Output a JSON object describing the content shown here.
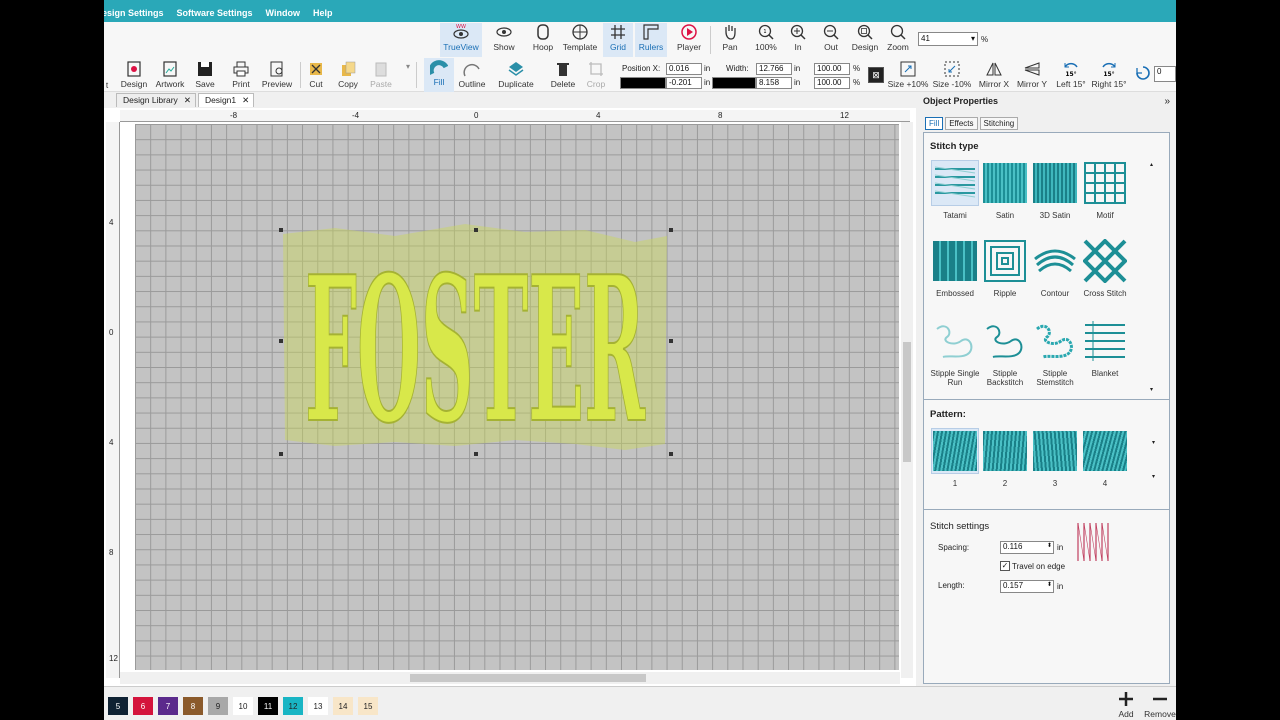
{
  "menu": [
    "esign Settings",
    "Software Settings",
    "Window",
    "Help"
  ],
  "toolbar_top": {
    "items": [
      "TrueView",
      "Show",
      "Hoop",
      "Template",
      "Grid",
      "Rulers",
      "Player",
      "Pan",
      "100%",
      "In",
      "Out",
      "Design",
      "Zoom"
    ],
    "zoom_value": "41",
    "zoom_unit": "%"
  },
  "toolbar_main": {
    "items": [
      "Design",
      "Artwork",
      "Save",
      "Print",
      "Preview",
      "Cut",
      "Copy",
      "Paste",
      "Fill",
      "Outline",
      "Duplicate",
      "Delete",
      "Crop"
    ],
    "position_label": "Position X:",
    "pos_x": "0.016",
    "pos_y": "-0.201",
    "unit": "in",
    "width_label": "Width:",
    "width": "12.766",
    "height": "8.158",
    "scale_x": "100.00",
    "scale_y": "100.00",
    "pct": "%",
    "right_items": [
      "Size +10%",
      "Size -10%",
      "Mirror X",
      "Mirror Y",
      "Left 15°",
      "Right 15°"
    ],
    "rotate_badge": "15°",
    "rotate_value": "0"
  },
  "doc_tabs": [
    "Design Library",
    "Design1"
  ],
  "ruler_top": [
    "-8",
    "-4",
    "0",
    "4",
    "8",
    "12"
  ],
  "ruler_left": [
    "4",
    "0",
    "4",
    "8",
    "12"
  ],
  "design_text": "FOSTER",
  "panel": {
    "title": "Object Properties",
    "tabs": [
      "Fill",
      "Effects",
      "Stitching"
    ],
    "stitch_type_label": "Stitch type",
    "stitch_types": [
      "Tatami",
      "Satin",
      "3D Satin",
      "Motif",
      "Embossed",
      "Ripple",
      "Contour",
      "Cross Stitch",
      "Stipple Single Run",
      "Stipple Backstitch",
      "Stipple Stemstitch",
      "Blanket"
    ],
    "pattern_label": "Pattern:",
    "patterns": [
      "1",
      "2",
      "3",
      "4"
    ],
    "stitch_settings_label": "Stitch settings",
    "spacing_label": "Spacing:",
    "spacing": "0.116",
    "travel_label": "Travel on edge",
    "length_label": "Length:",
    "length": "0.157",
    "unit": "in"
  },
  "colors": [
    {
      "n": "5",
      "c": "#0f2233",
      "fg": "#ffffff"
    },
    {
      "n": "6",
      "c": "#d4143c",
      "fg": "#ffffff"
    },
    {
      "n": "7",
      "c": "#5b2a8c",
      "fg": "#ffffff"
    },
    {
      "n": "8",
      "c": "#8b5a2b",
      "fg": "#ffffff"
    },
    {
      "n": "9",
      "c": "#a8a8a8",
      "fg": "#222222"
    },
    {
      "n": "10",
      "c": "#ffffff",
      "fg": "#222222"
    },
    {
      "n": "11",
      "c": "#000000",
      "fg": "#ffffff"
    },
    {
      "n": "12",
      "c": "#19b5c4",
      "fg": "#222222"
    },
    {
      "n": "13",
      "c": "#ffffff",
      "fg": "#222222"
    },
    {
      "n": "14",
      "c": "#f8e6c8",
      "fg": "#222222"
    },
    {
      "n": "15",
      "c": "#f8e6c8",
      "fg": "#222222"
    }
  ],
  "status_buttons": [
    "Add",
    "Remove"
  ]
}
